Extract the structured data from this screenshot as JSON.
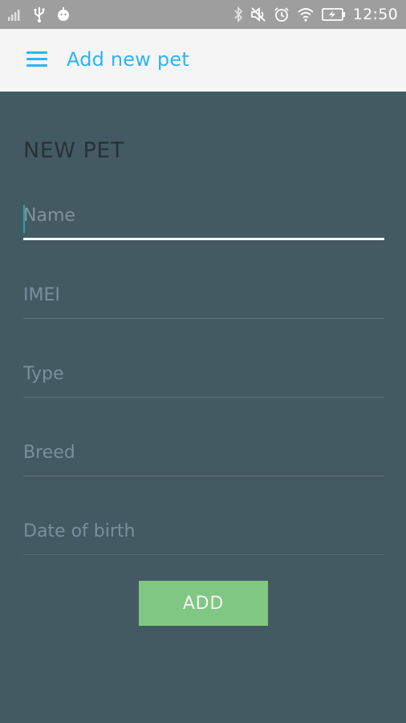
{
  "status_bar": {
    "time": "12:50",
    "left_icons": [
      "signal-icon",
      "usb-icon",
      "android-debug-icon"
    ],
    "right_icons": [
      "bluetooth-icon",
      "mute-icon",
      "alarm-icon",
      "wifi-icon",
      "battery-charging-icon"
    ]
  },
  "app_bar": {
    "menu_icon": "hamburger-menu-icon",
    "title": "Add new pet",
    "accent_color": "#29b6f6"
  },
  "form": {
    "heading": "NEW PET",
    "fields": [
      {
        "placeholder": "Name",
        "value": "",
        "focused": true
      },
      {
        "placeholder": "IMEI",
        "value": ""
      },
      {
        "placeholder": "Type",
        "value": ""
      },
      {
        "placeholder": "Breed",
        "value": ""
      },
      {
        "placeholder": "Date of birth",
        "value": ""
      }
    ],
    "submit_label": "ADD",
    "submit_color": "#81c784",
    "background_color": "#445a63"
  }
}
